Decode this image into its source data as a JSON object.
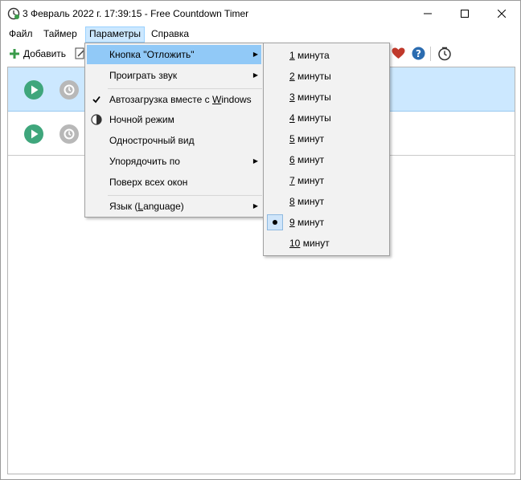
{
  "window": {
    "title": "3 Февраль 2022 г. 17:39:15 - Free Countdown Timer"
  },
  "menubar": {
    "items": [
      {
        "label": "Файл"
      },
      {
        "label": "Таймер"
      },
      {
        "label": "Параметры",
        "active": true
      },
      {
        "label": "Справка"
      }
    ]
  },
  "toolbar": {
    "add_label": "Добавить",
    "icons": [
      "plus-icon",
      "edit-icon",
      "heart-icon",
      "help-icon",
      "clock-icon"
    ]
  },
  "timers": [
    {
      "selected": true
    },
    {
      "selected": false
    }
  ],
  "params_menu": {
    "items": [
      {
        "label": "Кнопка \"Отложить\"",
        "submenu": true,
        "highlighted": true
      },
      {
        "label": "Проиграть звук",
        "submenu": true
      },
      {
        "label_pre": "Автозагрузка вместе с ",
        "label_u": "W",
        "label_post": "indows",
        "checked": true
      },
      {
        "label": "Ночной режим",
        "icon": "contrast-icon"
      },
      {
        "label": "Однострочный вид"
      },
      {
        "label": "Упорядочить по",
        "submenu": true
      },
      {
        "label": "Поверх всех окон"
      },
      {
        "label_pre": "Язык (",
        "label_u": "L",
        "label_post": "anguage)",
        "submenu": true
      }
    ]
  },
  "snooze_menu": {
    "items": [
      {
        "num": "1",
        "unit": " минута"
      },
      {
        "num": "2",
        "unit": " минуты"
      },
      {
        "num": "3",
        "unit": " минуты"
      },
      {
        "num": "4",
        "unit": " минуты"
      },
      {
        "num": "5",
        "unit": " минут"
      },
      {
        "num": "6",
        "unit": " минут"
      },
      {
        "num": "7",
        "unit": " минут"
      },
      {
        "num": "8",
        "unit": " минут"
      },
      {
        "num": "9",
        "unit": " минут",
        "selected": true
      },
      {
        "num": "10",
        "unit": " минут"
      }
    ]
  },
  "colors": {
    "accent": "#cce8ff",
    "menu_highlight": "#91c9f7",
    "play_green": "#3fa67c",
    "heart_red": "#c0392b",
    "help_blue": "#2b6cb0"
  }
}
